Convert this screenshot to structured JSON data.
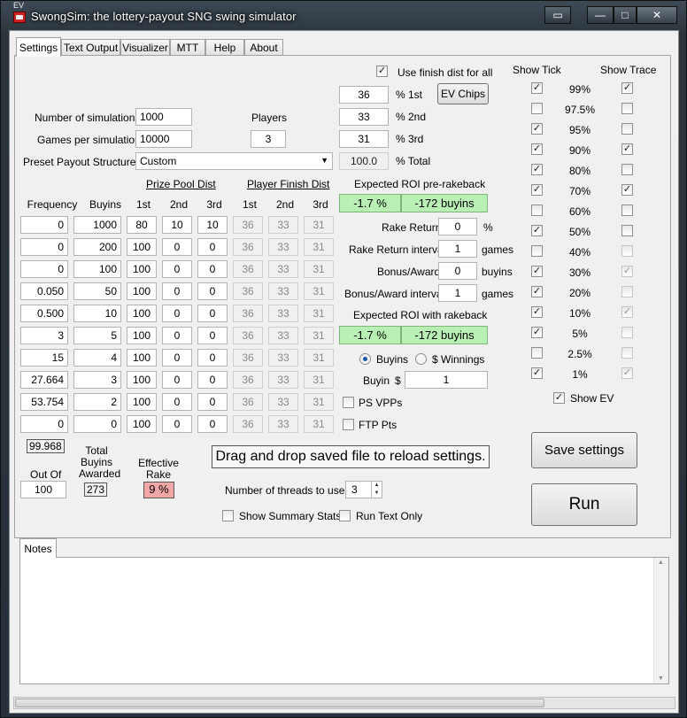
{
  "window": {
    "title": "SwongSim: the lottery-payout SNG swing simulator",
    "ev_tag": "EV",
    "buttons": {
      "minimize": "—",
      "maximize": "□",
      "close": "✕"
    }
  },
  "tabs": [
    "Settings",
    "Text Output",
    "Visualizer",
    "MTT",
    "Help",
    "About"
  ],
  "settings": {
    "num_sims_label": "Number of simulations",
    "num_sims": "1000",
    "games_label": "Games per simulation",
    "games": "10000",
    "preset_label": "Preset Payout Structures",
    "preset_value": "Custom",
    "players_label": "Players",
    "players": "3",
    "use_finish_dist_label": "Use finish dist for all",
    "finish_dist": [
      {
        "value": "36",
        "label": "% 1st"
      },
      {
        "value": "33",
        "label": "% 2nd"
      },
      {
        "value": "31",
        "label": "% 3rd"
      },
      {
        "value": "100.0",
        "label": "% Total"
      }
    ],
    "ev_chips_label": "EV Chips"
  },
  "table": {
    "group_prize": "Prize Pool Dist",
    "group_finish": "Player Finish Dist",
    "headers": [
      "Frequency",
      "Buyins",
      "1st",
      "2nd",
      "3rd",
      "1st",
      "2nd",
      "3rd"
    ],
    "rows": [
      [
        "0",
        "1000",
        "80",
        "10",
        "10",
        "36",
        "33",
        "31"
      ],
      [
        "0",
        "200",
        "100",
        "0",
        "0",
        "36",
        "33",
        "31"
      ],
      [
        "0",
        "100",
        "100",
        "0",
        "0",
        "36",
        "33",
        "31"
      ],
      [
        "0.050",
        "50",
        "100",
        "0",
        "0",
        "36",
        "33",
        "31"
      ],
      [
        "0.500",
        "10",
        "100",
        "0",
        "0",
        "36",
        "33",
        "31"
      ],
      [
        "3",
        "5",
        "100",
        "0",
        "0",
        "36",
        "33",
        "31"
      ],
      [
        "15",
        "4",
        "100",
        "0",
        "0",
        "36",
        "33",
        "31"
      ],
      [
        "27.664",
        "3",
        "100",
        "0",
        "0",
        "36",
        "33",
        "31"
      ],
      [
        "53.754",
        "2",
        "100",
        "0",
        "0",
        "36",
        "33",
        "31"
      ],
      [
        "0",
        "0",
        "100",
        "0",
        "0",
        "36",
        "33",
        "31"
      ]
    ],
    "freq_total": "99.968",
    "out_of_label": "Out Of",
    "out_of": "100",
    "total_buyins_label": "Total Buyins Awarded",
    "total_buyins": "273",
    "eff_rake_label": "Effective Rake",
    "eff_rake": "9 %"
  },
  "roi": {
    "pre_label": "Expected ROI pre-rakeback",
    "pre_pct": "-1.7 %",
    "pre_buyins": "-172 buyins",
    "rake_return_label": "Rake Return",
    "rake_return": "0",
    "rake_return_unit": "%",
    "rake_interval_label": "Rake Return interval",
    "rake_interval": "1",
    "rake_interval_unit": "games",
    "bonus_label": "Bonus/Award",
    "bonus": "0",
    "bonus_unit": "buyins",
    "bonus_interval_label": "Bonus/Award interval",
    "bonus_interval": "1",
    "bonus_interval_unit": "games",
    "with_label": "Expected ROI with rakeback",
    "with_pct": "-1.7 %",
    "with_buyins": "-172 buyins",
    "radio_buyins": "Buyins",
    "radio_winnings": "$ Winnings",
    "buyin_label": "Buyin",
    "buyin_currency": "$",
    "buyin_value": "1",
    "ps_vpps": "PS VPPs",
    "ftp_pts": "FTP Pts"
  },
  "ticks": {
    "show_tick_label": "Show Tick",
    "show_trace_label": "Show Trace",
    "items": [
      {
        "label": "99%",
        "tick": true,
        "trace": true,
        "trace_dim": false
      },
      {
        "label": "97.5%",
        "tick": false,
        "trace": false,
        "trace_dim": false
      },
      {
        "label": "95%",
        "tick": true,
        "trace": false,
        "trace_dim": false
      },
      {
        "label": "90%",
        "tick": true,
        "trace": true,
        "trace_dim": false
      },
      {
        "label": "80%",
        "tick": true,
        "trace": false,
        "trace_dim": false
      },
      {
        "label": "70%",
        "tick": true,
        "trace": true,
        "trace_dim": false
      },
      {
        "label": "60%",
        "tick": false,
        "trace": false,
        "trace_dim": false
      },
      {
        "label": "50%",
        "tick": true,
        "trace": false,
        "trace_dim": false
      },
      {
        "label": "40%",
        "tick": false,
        "trace": false,
        "trace_dim": true
      },
      {
        "label": "30%",
        "tick": true,
        "trace": true,
        "trace_dim": true
      },
      {
        "label": "20%",
        "tick": true,
        "trace": false,
        "trace_dim": true
      },
      {
        "label": "10%",
        "tick": true,
        "trace": true,
        "trace_dim": true
      },
      {
        "label": "5%",
        "tick": true,
        "trace": false,
        "trace_dim": true
      },
      {
        "label": "2.5%",
        "tick": false,
        "trace": false,
        "trace_dim": true
      },
      {
        "label": "1%",
        "tick": true,
        "trace": true,
        "trace_dim": true
      }
    ],
    "show_ev_label": "Show EV"
  },
  "actions": {
    "drag_drop": "Drag and drop saved file to reload settings.",
    "save": "Save settings",
    "run": "Run",
    "threads_label": "Number of threads to use",
    "threads": "3",
    "summary_label": "Show Summary Stats",
    "text_only_label": "Run Text Only"
  },
  "notes": {
    "tab": "Notes"
  },
  "colors": {
    "roi_green": "#b9f1b5",
    "rake_pink": "#f2a6a6"
  }
}
